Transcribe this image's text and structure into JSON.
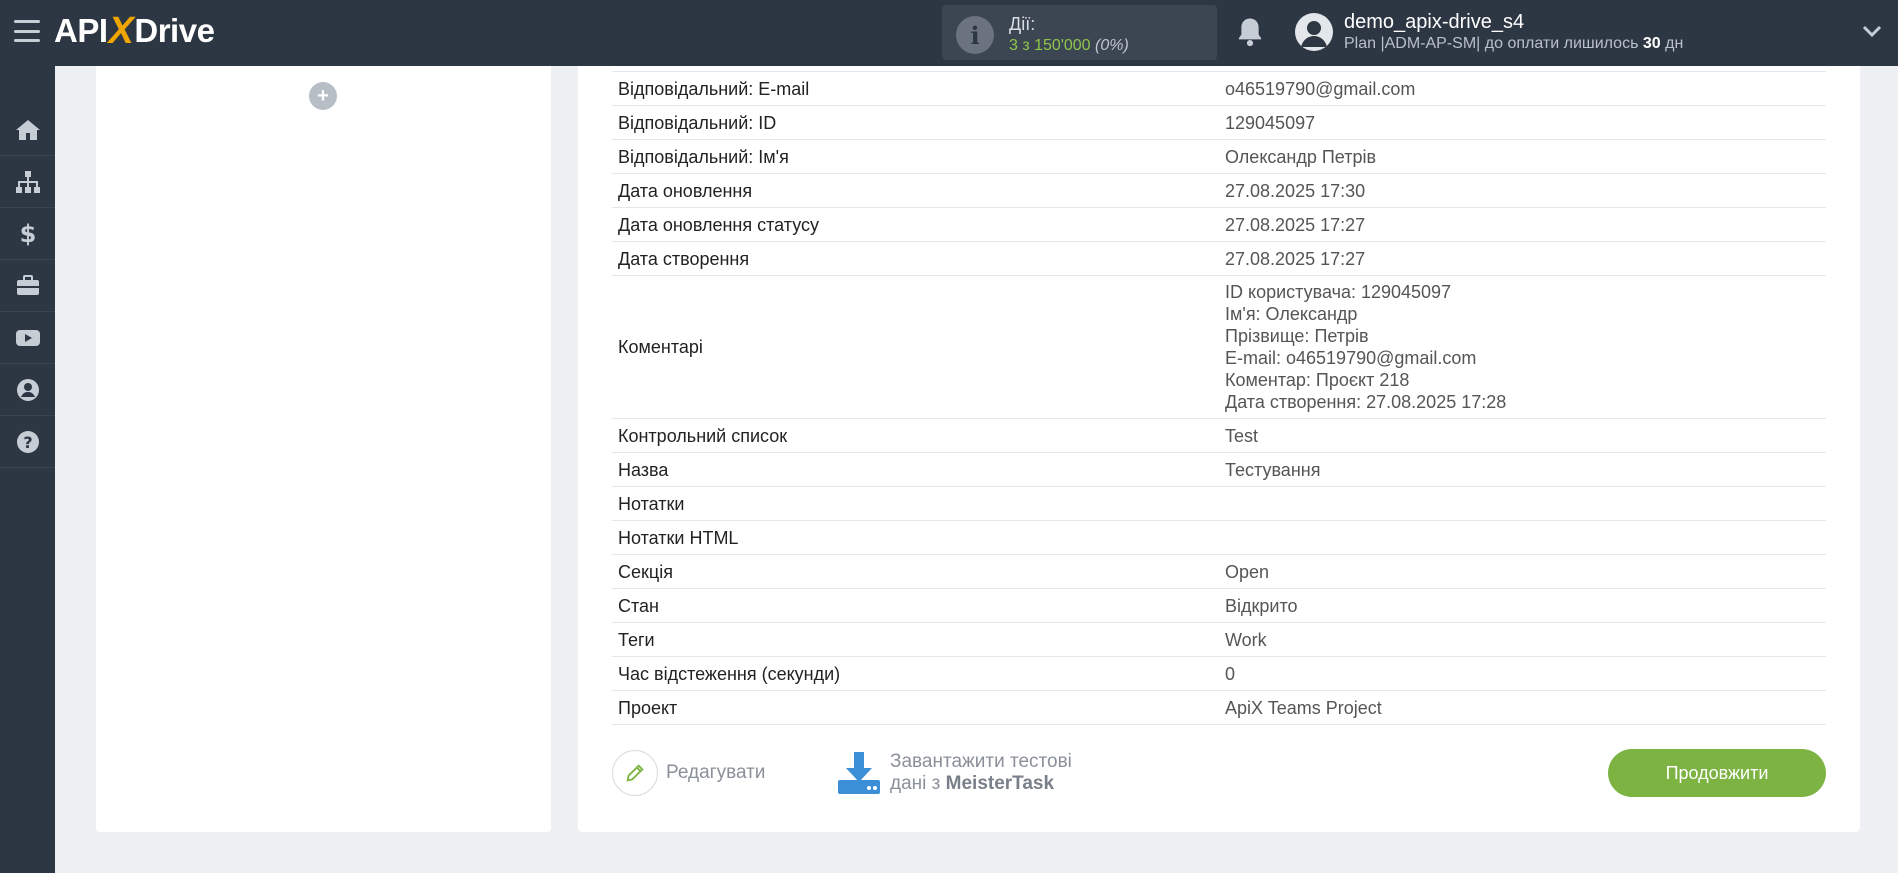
{
  "header": {
    "logo_api": "API",
    "logo_x": "X",
    "logo_drive": "Drive",
    "actions_label": "Дії:",
    "actions_count": "3 з 150'000",
    "actions_percent": "(0%)",
    "user_name": "demo_apix-drive_s4",
    "plan_prefix": "Plan |ADM-AP-SM| до оплати лишилось ",
    "plan_days": "30",
    "plan_suffix": " дн"
  },
  "sidebar": {
    "items": [
      {
        "icon": "home-icon"
      },
      {
        "icon": "sitemap-icon"
      },
      {
        "icon": "dollar-icon"
      },
      {
        "icon": "briefcase-icon"
      },
      {
        "icon": "youtube-icon"
      },
      {
        "icon": "user-circle-icon"
      },
      {
        "icon": "question-icon"
      }
    ]
  },
  "left_panel": {
    "add_symbol": "+"
  },
  "table": {
    "rows": [
      {
        "key": "Відповідальний: E-mail",
        "value": "o46519790@gmail.com"
      },
      {
        "key": "Відповідальний: ID",
        "value": "129045097"
      },
      {
        "key": "Відповідальний: Ім'я",
        "value": "Олександр Петрів"
      },
      {
        "key": "Дата оновлення",
        "value": "27.08.2025 17:30"
      },
      {
        "key": "Дата оновлення статусу",
        "value": "27.08.2025 17:27"
      },
      {
        "key": "Дата створення",
        "value": "27.08.2025 17:27"
      },
      {
        "key": "Коментарі",
        "lines": [
          "ID користувача: 129045097",
          "Ім'я: Олександр",
          "Прізвище: Петрів",
          "E-mail: o46519790@gmail.com",
          "Коментар: Проєкт 218",
          "Дата створення: 27.08.2025 17:28"
        ]
      },
      {
        "key": "Контрольний список",
        "value": "Test"
      },
      {
        "key": "Назва",
        "value": "Тестування"
      },
      {
        "key": "Нотатки",
        "value": ""
      },
      {
        "key": "Нотатки HTML",
        "value": ""
      },
      {
        "key": "Секція",
        "value": "Open"
      },
      {
        "key": "Стан",
        "value": "Відкрито"
      },
      {
        "key": "Теги",
        "value": "Work"
      },
      {
        "key": "Час відстеження (секунди)",
        "value": "0"
      },
      {
        "key": "Проект",
        "value": "ApiX Teams Project"
      }
    ]
  },
  "footer": {
    "edit_label": "Редагувати",
    "download_line1": "Завантажити тестові",
    "download_line2_prefix": "дані з ",
    "download_service": "MeisterTask",
    "continue_label": "Продовжити"
  },
  "colors": {
    "topbar": "#2d3643",
    "accent_green": "#7cb342",
    "download_blue": "#3a8fd6"
  }
}
